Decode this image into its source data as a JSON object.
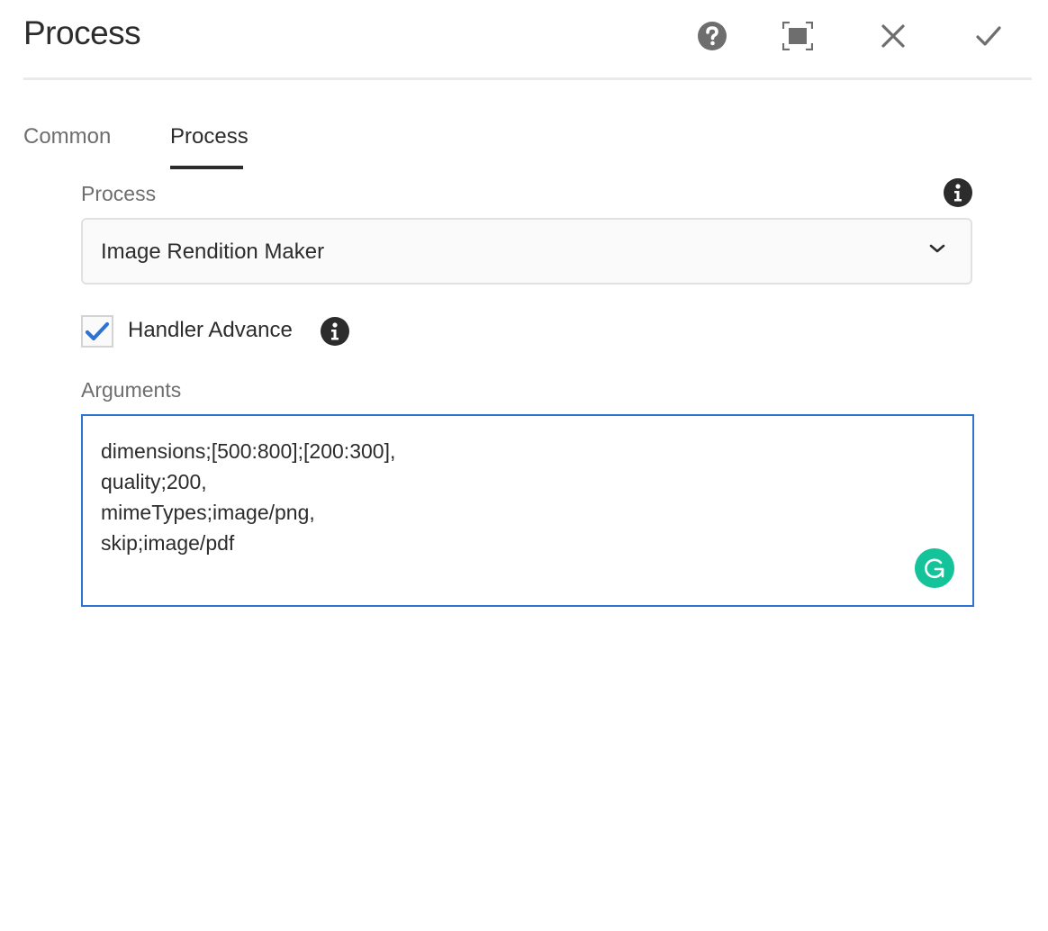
{
  "dialog": {
    "title": "Process",
    "icons": {
      "help": "help-icon",
      "fullscreen": "fullscreen-icon",
      "close": "close-icon",
      "done": "checkmark-icon"
    }
  },
  "tabs": [
    {
      "label": "Common",
      "active": false
    },
    {
      "label": "Process",
      "active": true
    }
  ],
  "form": {
    "process": {
      "label": "Process",
      "value": "Image Rendition Maker",
      "info_icon": "info-icon"
    },
    "handler_advance": {
      "label": "Handler Advance",
      "checked": true,
      "info_icon": "info-icon"
    },
    "arguments": {
      "label": "Arguments",
      "value": "dimensions;[500:800];[200:300],\nquality;200,\nmimeTypes;image/png,\nskip;image/pdf"
    }
  },
  "colors": {
    "accent": "#2e72d2",
    "text": "#2c2c2c",
    "muted": "#6e6e6e",
    "grammarly": "#15c39a"
  }
}
